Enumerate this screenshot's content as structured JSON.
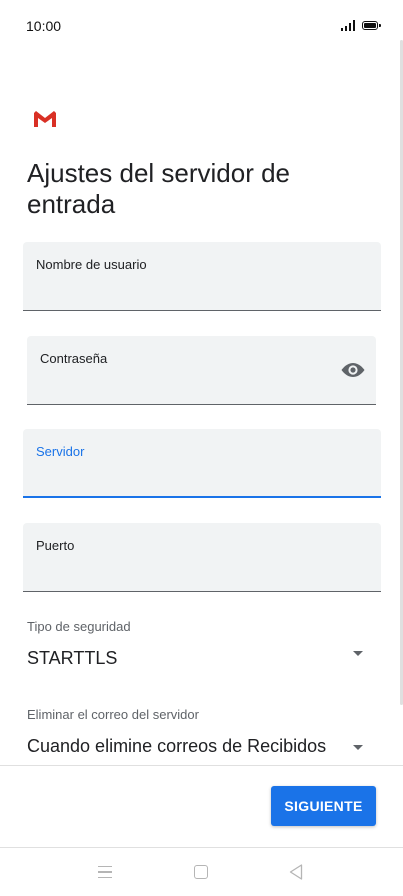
{
  "status_bar": {
    "time": "10:00"
  },
  "header": {
    "title": "Ajustes del servidor de entrada"
  },
  "form": {
    "username": {
      "label": "Nombre de usuario",
      "value": ""
    },
    "password": {
      "label": "Contraseña",
      "value": ""
    },
    "server": {
      "label": "Servidor",
      "value": ""
    },
    "port": {
      "label": "Puerto",
      "value": ""
    },
    "security_type": {
      "label": "Tipo de seguridad",
      "value": "STARTTLS"
    },
    "delete_email": {
      "label": "Eliminar el correo del servidor",
      "value": "Cuando elimine correos de Recibidos"
    }
  },
  "footer": {
    "next_label": "SIGUIENTE"
  },
  "colors": {
    "accent": "#1a73e8",
    "field_bg": "#f1f3f4",
    "gmail_red": "#d93025"
  },
  "icons": [
    "signal-icon",
    "battery-icon",
    "gmail-logo",
    "eye-icon",
    "dropdown-arrow-icon",
    "nav-menu-icon",
    "nav-home-icon",
    "nav-back-icon"
  ]
}
